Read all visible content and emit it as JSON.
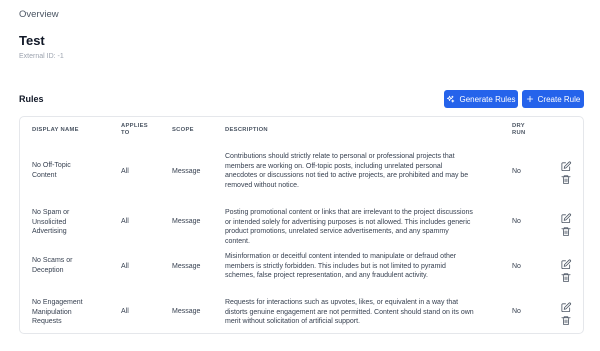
{
  "breadcrumb": "Overview",
  "page": {
    "title": "Test",
    "external_id": "External ID: -1"
  },
  "rules_section": {
    "title": "Rules",
    "generate_button": "Generate Rules",
    "create_button": "Create Rule"
  },
  "table": {
    "headers": {
      "display_name": "DISPLAY NAME",
      "applies_to_1": "APPLIES",
      "applies_to_2": "TO",
      "scope": "SCOPE",
      "description": "DESCRIPTION",
      "dry_run_1": "DRY",
      "dry_run_2": "RUN"
    },
    "rows": [
      {
        "name_1": "No Off-Topic",
        "name_2": "Content",
        "name_3": "",
        "applies_to": "All",
        "scope": "Message",
        "desc_1": "Contributions should strictly relate to personal or professional projects that",
        "desc_2": "members are working on. Off-topic posts, including unrelated personal",
        "desc_3": "anecdotes or discussions not tied to active projects, are prohibited and may be",
        "desc_4": "removed without notice.",
        "dry_run": "No"
      },
      {
        "name_1": "No Spam or",
        "name_2": "Unsolicited",
        "name_3": "Advertising",
        "applies_to": "All",
        "scope": "Message",
        "desc_1": "Posting promotional content or links that are irrelevant to the project discussions",
        "desc_2": "or intended solely for advertising purposes is not allowed. This includes generic",
        "desc_3": "product promotions, unrelated service advertisements, and any spammy content.",
        "desc_4": "",
        "dry_run": "No"
      },
      {
        "name_1": "No Scams or",
        "name_2": "Deception",
        "name_3": "",
        "applies_to": "All",
        "scope": "Message",
        "desc_1": "Misinformation or deceitful content intended to manipulate or defraud other",
        "desc_2": "members is strictly forbidden. This includes but is not limited to pyramid",
        "desc_3": "schemes, false project representation, and any fraudulent activity.",
        "desc_4": "",
        "dry_run": "No"
      },
      {
        "name_1": "No Engagement",
        "name_2": "Manipulation",
        "name_3": "Requests",
        "applies_to": "All",
        "scope": "Message",
        "desc_1": "Requests for interactions such as upvotes, likes, or equivalent in a way that",
        "desc_2": "distorts genuine engagement are not permitted. Content should stand on its own",
        "desc_3": "merit without solicitation of artificial support.",
        "desc_4": "",
        "dry_run": "No"
      }
    ]
  },
  "icons": {
    "edit": "pencil-square-icon",
    "delete": "trash-icon",
    "generate": "sparkles-icon",
    "create": "plus-icon"
  },
  "colors": {
    "primary": "#2563eb",
    "border": "#e5e7eb",
    "text": "#374151",
    "header_text": "#4b5563"
  }
}
